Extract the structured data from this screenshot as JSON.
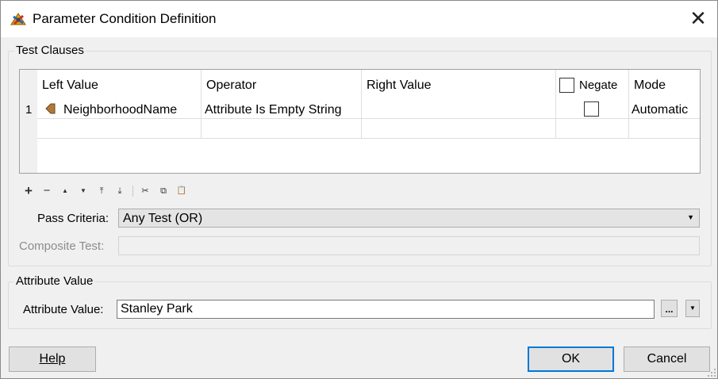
{
  "window": {
    "title": "Parameter Condition Definition",
    "close_glyph": "✕"
  },
  "test_clauses": {
    "group_label": "Test Clauses",
    "columns": {
      "left_value": "Left Value",
      "operator": "Operator",
      "right_value": "Right Value",
      "negate": "Negate",
      "mode": "Mode"
    },
    "rows": [
      {
        "num": "1",
        "left_value": "NeighborhoodName",
        "operator": "Attribute Is Empty String",
        "right_value": "",
        "negate": false,
        "mode": "Automatic"
      }
    ],
    "toolbar": {
      "add": "+",
      "remove": "−",
      "move_up": "▲",
      "move_down": "▼",
      "move_top": "⤒",
      "move_bottom": "⤓",
      "cut": "✂",
      "copy": "⧉",
      "paste": "📋"
    },
    "pass_criteria": {
      "label": "Pass Criteria:",
      "value": "Any Test (OR)"
    },
    "composite_test": {
      "label": "Composite Test:",
      "value": ""
    }
  },
  "attribute_value": {
    "group_label": "Attribute Value",
    "label": "Attribute Value:",
    "value": "Stanley Park",
    "ellipsis": "...",
    "dropdown_glyph": "▼"
  },
  "buttons": {
    "help": "Help",
    "ok": "OK",
    "cancel": "Cancel"
  },
  "colors": {
    "accent": "#0078d7",
    "background": "#f0f0f0"
  }
}
